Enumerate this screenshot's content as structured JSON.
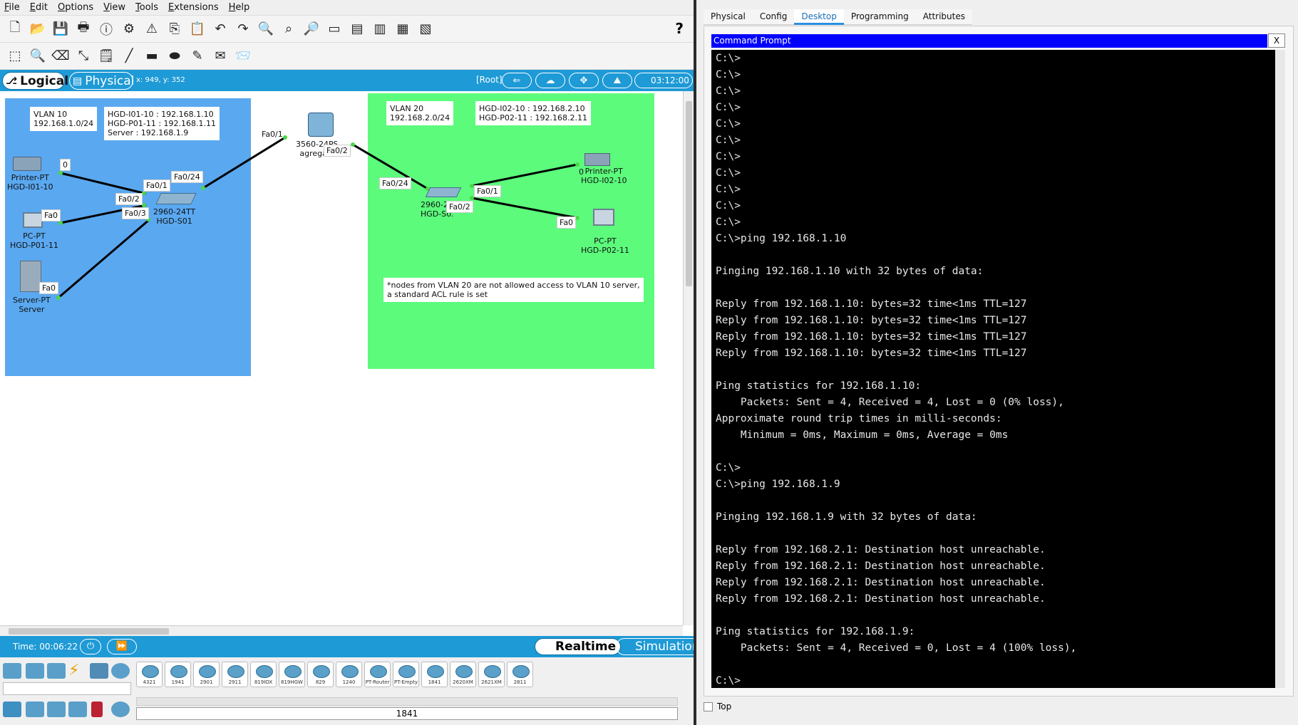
{
  "menu": [
    "File",
    "Edit",
    "Options",
    "View",
    "Tools",
    "Extensions",
    "Help"
  ],
  "workspace": {
    "logical_tab": "Logical",
    "physical_tab": "Physical",
    "coords": "x: 949, y: 352",
    "root": "[Root]",
    "clock": "03:12:00"
  },
  "canvas": {
    "vlan10_title": "VLAN 10\n192.168.1.0/24",
    "vlan10_hosts": "HGD-I01-10 : 192.168.1.10\nHGD-P01-11 : 192.168.1.11\nServer : 192.168.1.9",
    "vlan20_title": "VLAN 20\n192.168.2.0/24",
    "vlan20_hosts": "HGD-I02-10 : 192.168.2.10\nHGD-P02-11 : 192.168.2.11",
    "acl_note": "*nodes from VLAN 20 are not allowed access to VLAN 10 server,\na standard ACL rule is set",
    "devices": {
      "printer1": "Printer-PT\nHGD-I01-10",
      "pc1": "PC-PT\nHGD-P01-11",
      "server": "Server-PT\nServer",
      "s01": "2960-24TT\nHGD-S01",
      "core": "3560-24PS\nagregasi",
      "s02": "2960-24TT\nHGD-S02",
      "printer2": "Printer-PT\nHGD-I02-10",
      "pc2": "PC-PT\nHGD-P02-11"
    },
    "ports": {
      "p1": "0",
      "pc1": "Fa0",
      "srv": "Fa0",
      "s01_fa01": "Fa0/1",
      "s01_fa02": "Fa0/2",
      "s01_fa03": "Fa0/3",
      "s01_fa024": "Fa0/24",
      "core_fa01": "Fa0/1",
      "core_fa02": "Fa0/2",
      "s02_fa024": "Fa0/24",
      "s02_fa01": "Fa0/1",
      "s02_fa02": "Fa0/2",
      "p2": "0",
      "pc2": "Fa0"
    }
  },
  "status": {
    "time": "Time: 00:06:22",
    "realtime": "Realtime",
    "simulation": "Simulation"
  },
  "palette": {
    "routers": [
      "4321",
      "1941",
      "2901",
      "2911",
      "819IOX",
      "819HGW",
      "829",
      "1240",
      "PT-Router",
      "PT-Empty",
      "1841",
      "2620XM",
      "2621XM",
      "2811"
    ],
    "selected_model": "1841"
  },
  "right": {
    "tabs": [
      "Physical",
      "Config",
      "Desktop",
      "Programming",
      "Attributes"
    ],
    "active_tab": "Desktop",
    "cmd_title": "Command Prompt",
    "close": "X",
    "top_label": "Top",
    "terminal": "C:\\>\nC:\\>\nC:\\>\nC:\\>\nC:\\>\nC:\\>\nC:\\>\nC:\\>\nC:\\>\nC:\\>\nC:\\>\nC:\\>ping 192.168.1.10\n\nPinging 192.168.1.10 with 32 bytes of data:\n\nReply from 192.168.1.10: bytes=32 time<1ms TTL=127\nReply from 192.168.1.10: bytes=32 time<1ms TTL=127\nReply from 192.168.1.10: bytes=32 time<1ms TTL=127\nReply from 192.168.1.10: bytes=32 time<1ms TTL=127\n\nPing statistics for 192.168.1.10:\n    Packets: Sent = 4, Received = 4, Lost = 0 (0% loss),\nApproximate round trip times in milli-seconds:\n    Minimum = 0ms, Maximum = 0ms, Average = 0ms\n\nC:\\>\nC:\\>ping 192.168.1.9\n\nPinging 192.168.1.9 with 32 bytes of data:\n\nReply from 192.168.2.1: Destination host unreachable.\nReply from 192.168.2.1: Destination host unreachable.\nReply from 192.168.2.1: Destination host unreachable.\nReply from 192.168.2.1: Destination host unreachable.\n\nPing statistics for 192.168.1.9:\n    Packets: Sent = 4, Received = 0, Lost = 4 (100% loss),\n\nC:\\>"
  },
  "colors": {
    "vlan10": "#5aa8f0",
    "vlan20": "#5cfb7c",
    "accent": "#1e9ad6",
    "cmd_title": "#0000ff"
  }
}
